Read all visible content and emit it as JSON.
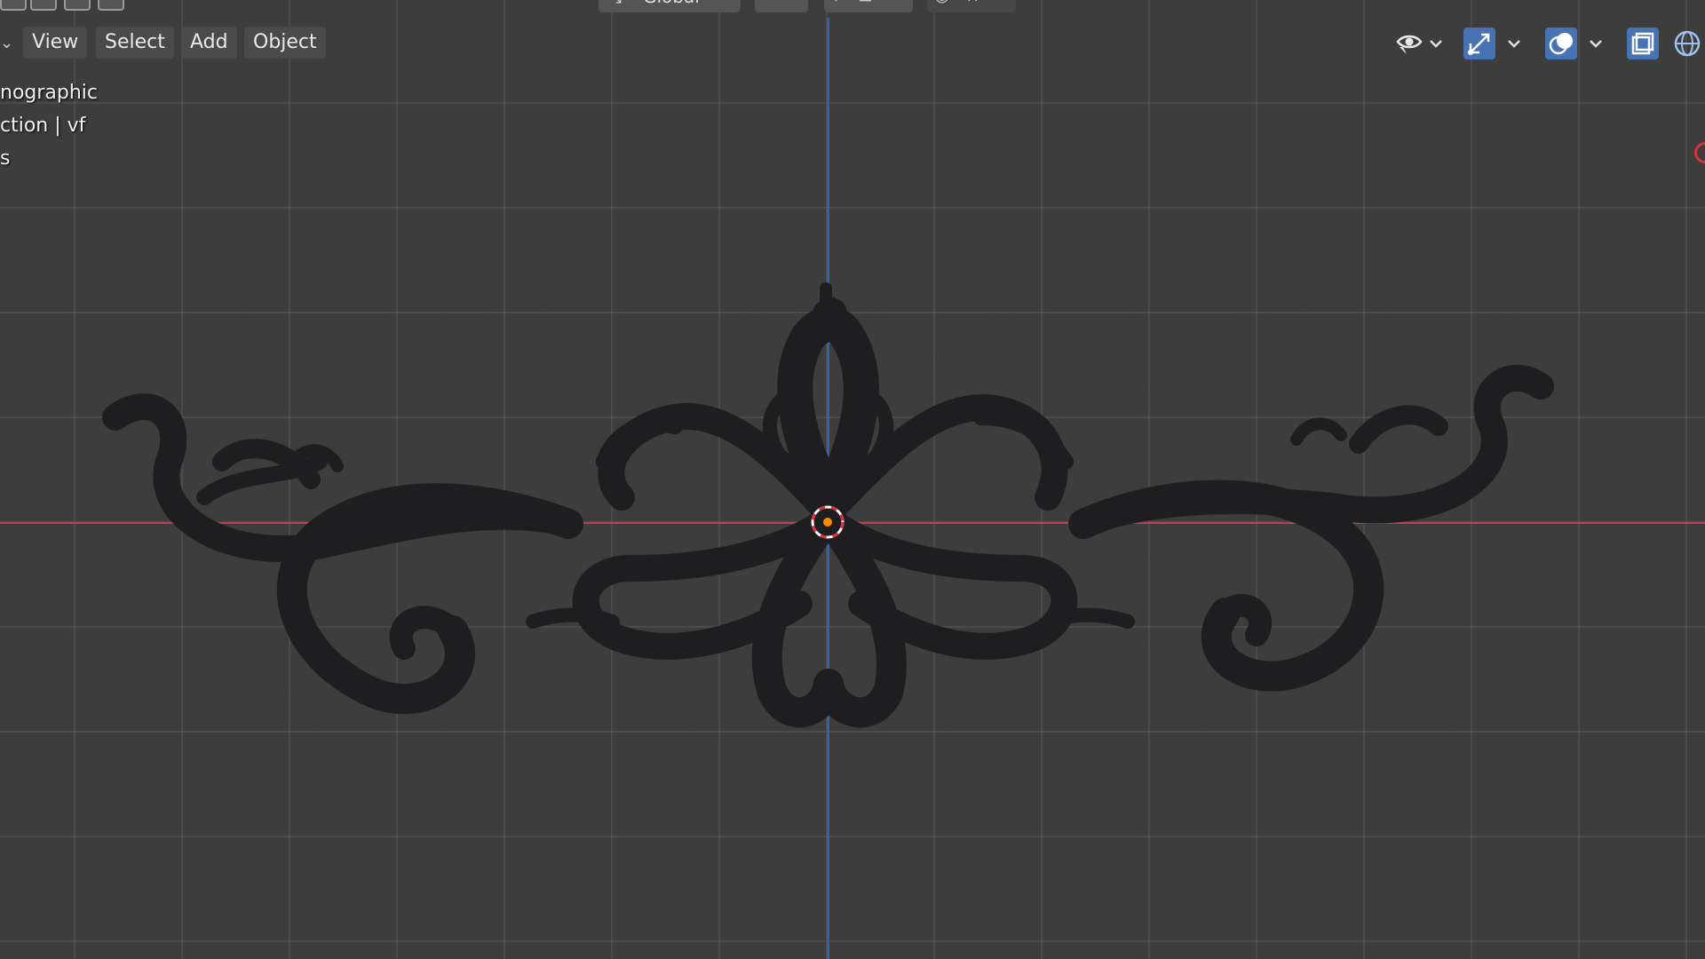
{
  "menu": {
    "view": "View",
    "select": "Select",
    "add": "Add",
    "object": "Object"
  },
  "transform_orientation": {
    "value": "Global"
  },
  "overlay_text": {
    "line1": "nographic",
    "line2": "ction | vf",
    "line3": "s"
  },
  "colors": {
    "background": "#3d3d3d",
    "x_axis": "#b5444f",
    "y_axis": "#2e63a8",
    "active_button": "#4772b3",
    "model": "#1e1e20",
    "origin": "#ff8a00"
  },
  "icons": {
    "visibility": "eye-icon",
    "gizmo": "gizmo-icon",
    "overlays": "overlays-icon",
    "xray": "xray-icon",
    "shading": "wireframe-sphere-icon",
    "orientation": "transform-orientation-icon",
    "pivot": "pivot-icon",
    "snap": "snap-icon",
    "proportional": "proportional-edit-icon"
  }
}
